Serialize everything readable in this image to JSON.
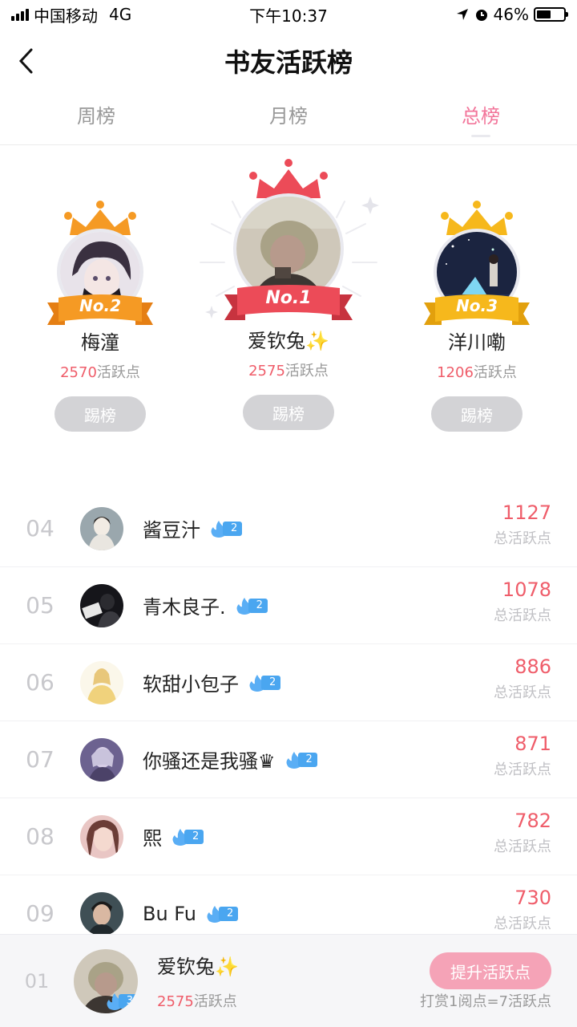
{
  "status": {
    "carrier": "中国移动",
    "network": "4G",
    "time": "下午10:37",
    "battery": "46%",
    "battery_level": 0.46
  },
  "header": {
    "title": "书友活跃榜"
  },
  "tabs": [
    {
      "label": "周榜",
      "active": false
    },
    {
      "label": "月榜",
      "active": false
    },
    {
      "label": "总榜",
      "active": true
    }
  ],
  "podium": {
    "first": {
      "rank": "No.1",
      "name": "爱钦兔✨",
      "points": "2575",
      "points_suffix": "活跃点",
      "button": "踢榜"
    },
    "second": {
      "rank": "No.2",
      "name": "梅潼",
      "points": "2570",
      "points_suffix": "活跃点",
      "button": "踢榜"
    },
    "third": {
      "rank": "No.3",
      "name": "洋川嘞",
      "points": "1206",
      "points_suffix": "活跃点",
      "button": "踢榜"
    }
  },
  "list": [
    {
      "rank": "04",
      "name": "酱豆汁",
      "level": "2",
      "score": "1127",
      "score_label": "总活跃点"
    },
    {
      "rank": "05",
      "name": "青木良子.",
      "level": "2",
      "score": "1078",
      "score_label": "总活跃点"
    },
    {
      "rank": "06",
      "name": "软甜小包子",
      "level": "2",
      "score": "886",
      "score_label": "总活跃点"
    },
    {
      "rank": "07",
      "name": "你骚还是我骚♛",
      "level": "2",
      "score": "871",
      "score_label": "总活跃点"
    },
    {
      "rank": "08",
      "name": "熙",
      "level": "2",
      "score": "782",
      "score_label": "总活跃点"
    },
    {
      "rank": "09",
      "name": "Bu Fu",
      "level": "2",
      "score": "730",
      "score_label": "总活跃点"
    }
  ],
  "me": {
    "rank": "01",
    "name": "爱钦兔✨",
    "level": "3",
    "points": "2575",
    "points_suffix": "活跃点",
    "button": "提升活跃点",
    "note": "打赏1阅点=7活跃点"
  },
  "colors": {
    "accent_pink": "#f2759a",
    "score_red": "#ef5d6a",
    "gold": "#f6b81c",
    "orange": "#f59a24",
    "red": "#ec4b58"
  }
}
